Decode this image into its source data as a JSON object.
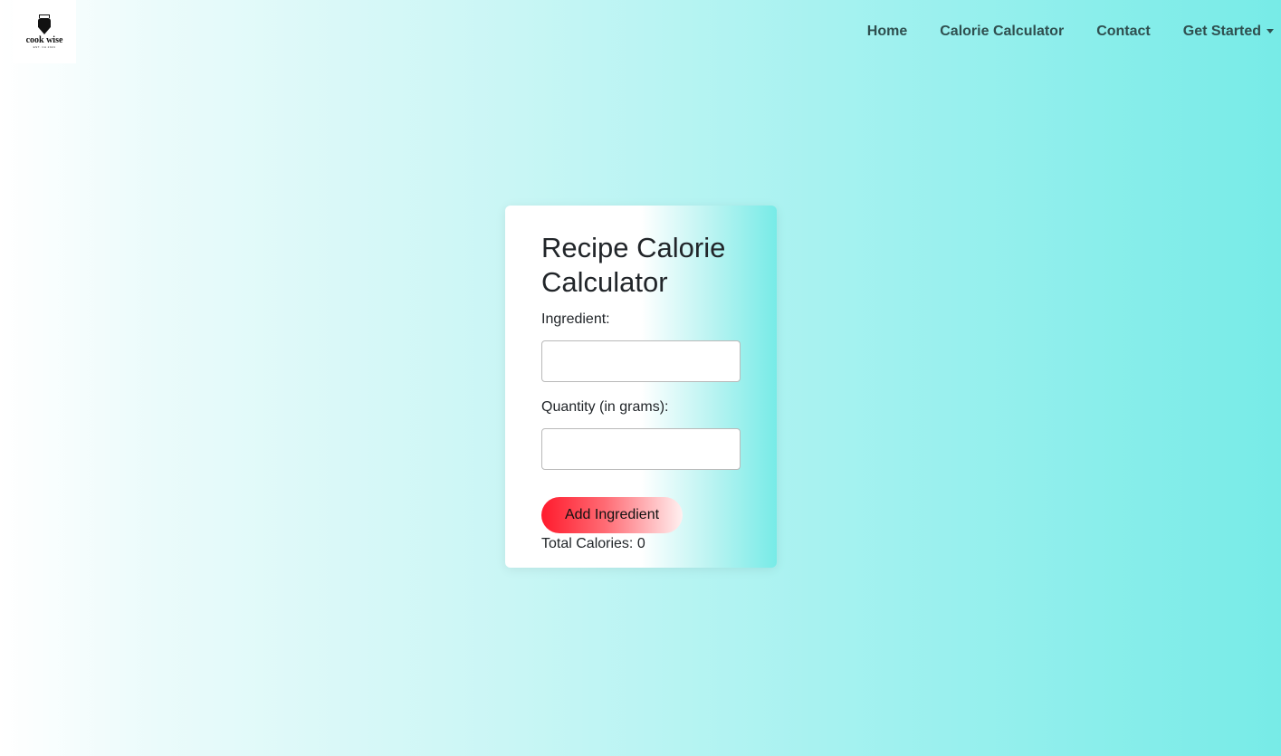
{
  "brand": {
    "logo_text": "cook wise",
    "logo_subtext": "EST. CA 2024"
  },
  "nav": {
    "items": [
      {
        "label": "Home"
      },
      {
        "label": "Calorie Calculator"
      },
      {
        "label": "Contact"
      },
      {
        "label": "Get Started",
        "dropdown": true
      }
    ]
  },
  "card": {
    "title": "Recipe Calorie Calculator",
    "ingredient_label": "Ingredient:",
    "ingredient_value": "",
    "quantity_label": "Quantity (in grams):",
    "quantity_value": "",
    "add_button_label": "Add Ingredient",
    "total_label": "Total Calories: ",
    "total_value": "0"
  },
  "colors": {
    "gradient_start": "#ffffff",
    "gradient_end": "#77ebe7",
    "button_accent": "#ff1a2c",
    "nav_text": "#2f4f4f"
  }
}
